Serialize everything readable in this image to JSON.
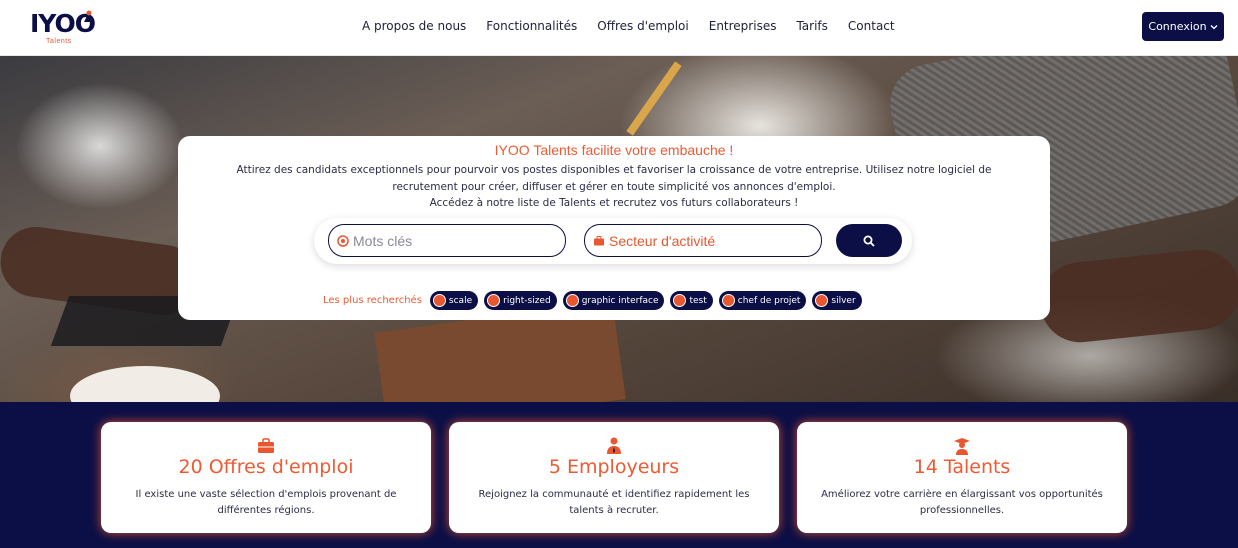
{
  "header": {
    "logo_text": "IYOO",
    "logo_sub": "Talents",
    "nav": [
      "A propos de nous",
      "Fonctionnalités",
      "Offres d'emploi",
      "Entreprises",
      "Tarifs",
      "Contact"
    ],
    "login_label": "Connexion",
    "login_icon": "chevron-down-icon"
  },
  "hero": {
    "title": "IYOO Talents facilite votre embauche !",
    "description": "Attirez des candidats exceptionnels pour pourvoir vos postes disponibles et favoriser la croissance de votre entreprise. Utilisez notre logiciel de recrutement pour créer, diffuser et gérer en toute simplicité vos annonces d'emploi.",
    "description2": "Accédez à notre liste de Talents et recrutez vos futurs collaborateurs !",
    "search": {
      "keywords_placeholder": "Mots clés",
      "sector_placeholder": "Secteur d'activité",
      "button_icon": "search-icon"
    },
    "popular_label": "Les plus recherchés",
    "tags": [
      "scale",
      "right-sized",
      "graphic interface",
      "test",
      "chef de projet",
      "silver"
    ]
  },
  "stats": [
    {
      "title": "20 Offres d'emploi",
      "icon": "briefcase-icon",
      "description": "Il existe une vaste sélection d'emplois provenant de différentes régions."
    },
    {
      "title": "5 Employeurs",
      "icon": "employer-icon",
      "description": "Rejoignez la communauté et identifiez rapidement les talents à recruter."
    },
    {
      "title": "14 Talents",
      "icon": "graduate-icon",
      "description": "Améliorez votre carrière en élargissant vos opportunités professionnelles."
    }
  ],
  "colors": {
    "primary": "#0c0f45",
    "accent": "#ee5a32"
  }
}
